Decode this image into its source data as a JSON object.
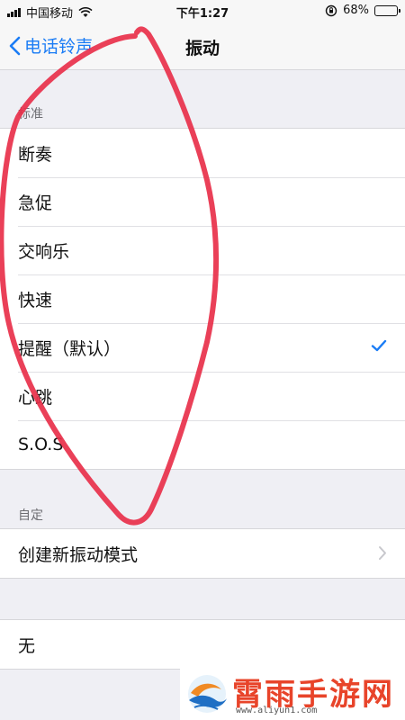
{
  "status_bar": {
    "carrier": "中国移动",
    "time": "下午1:27",
    "battery_percent": "68%",
    "battery_level": 0.68
  },
  "nav": {
    "back_label": "电话铃声",
    "title": "振动"
  },
  "standard": {
    "header": "标准",
    "items": [
      {
        "label": "断奏",
        "selected": false
      },
      {
        "label": "急促",
        "selected": false
      },
      {
        "label": "交响乐",
        "selected": false
      },
      {
        "label": "快速",
        "selected": false
      },
      {
        "label": "提醒（默认）",
        "selected": true
      },
      {
        "label": "心跳",
        "selected": false
      },
      {
        "label": "S.O.S",
        "selected": false
      }
    ]
  },
  "custom": {
    "header": "自定",
    "create_label": "创建新振动模式"
  },
  "none": {
    "label": "无"
  },
  "watermark": {
    "brand": "霄雨手游网",
    "url": "www.aliyun1.com"
  },
  "colors": {
    "accent": "#1a7cf5",
    "annotation": "#e8304a"
  }
}
